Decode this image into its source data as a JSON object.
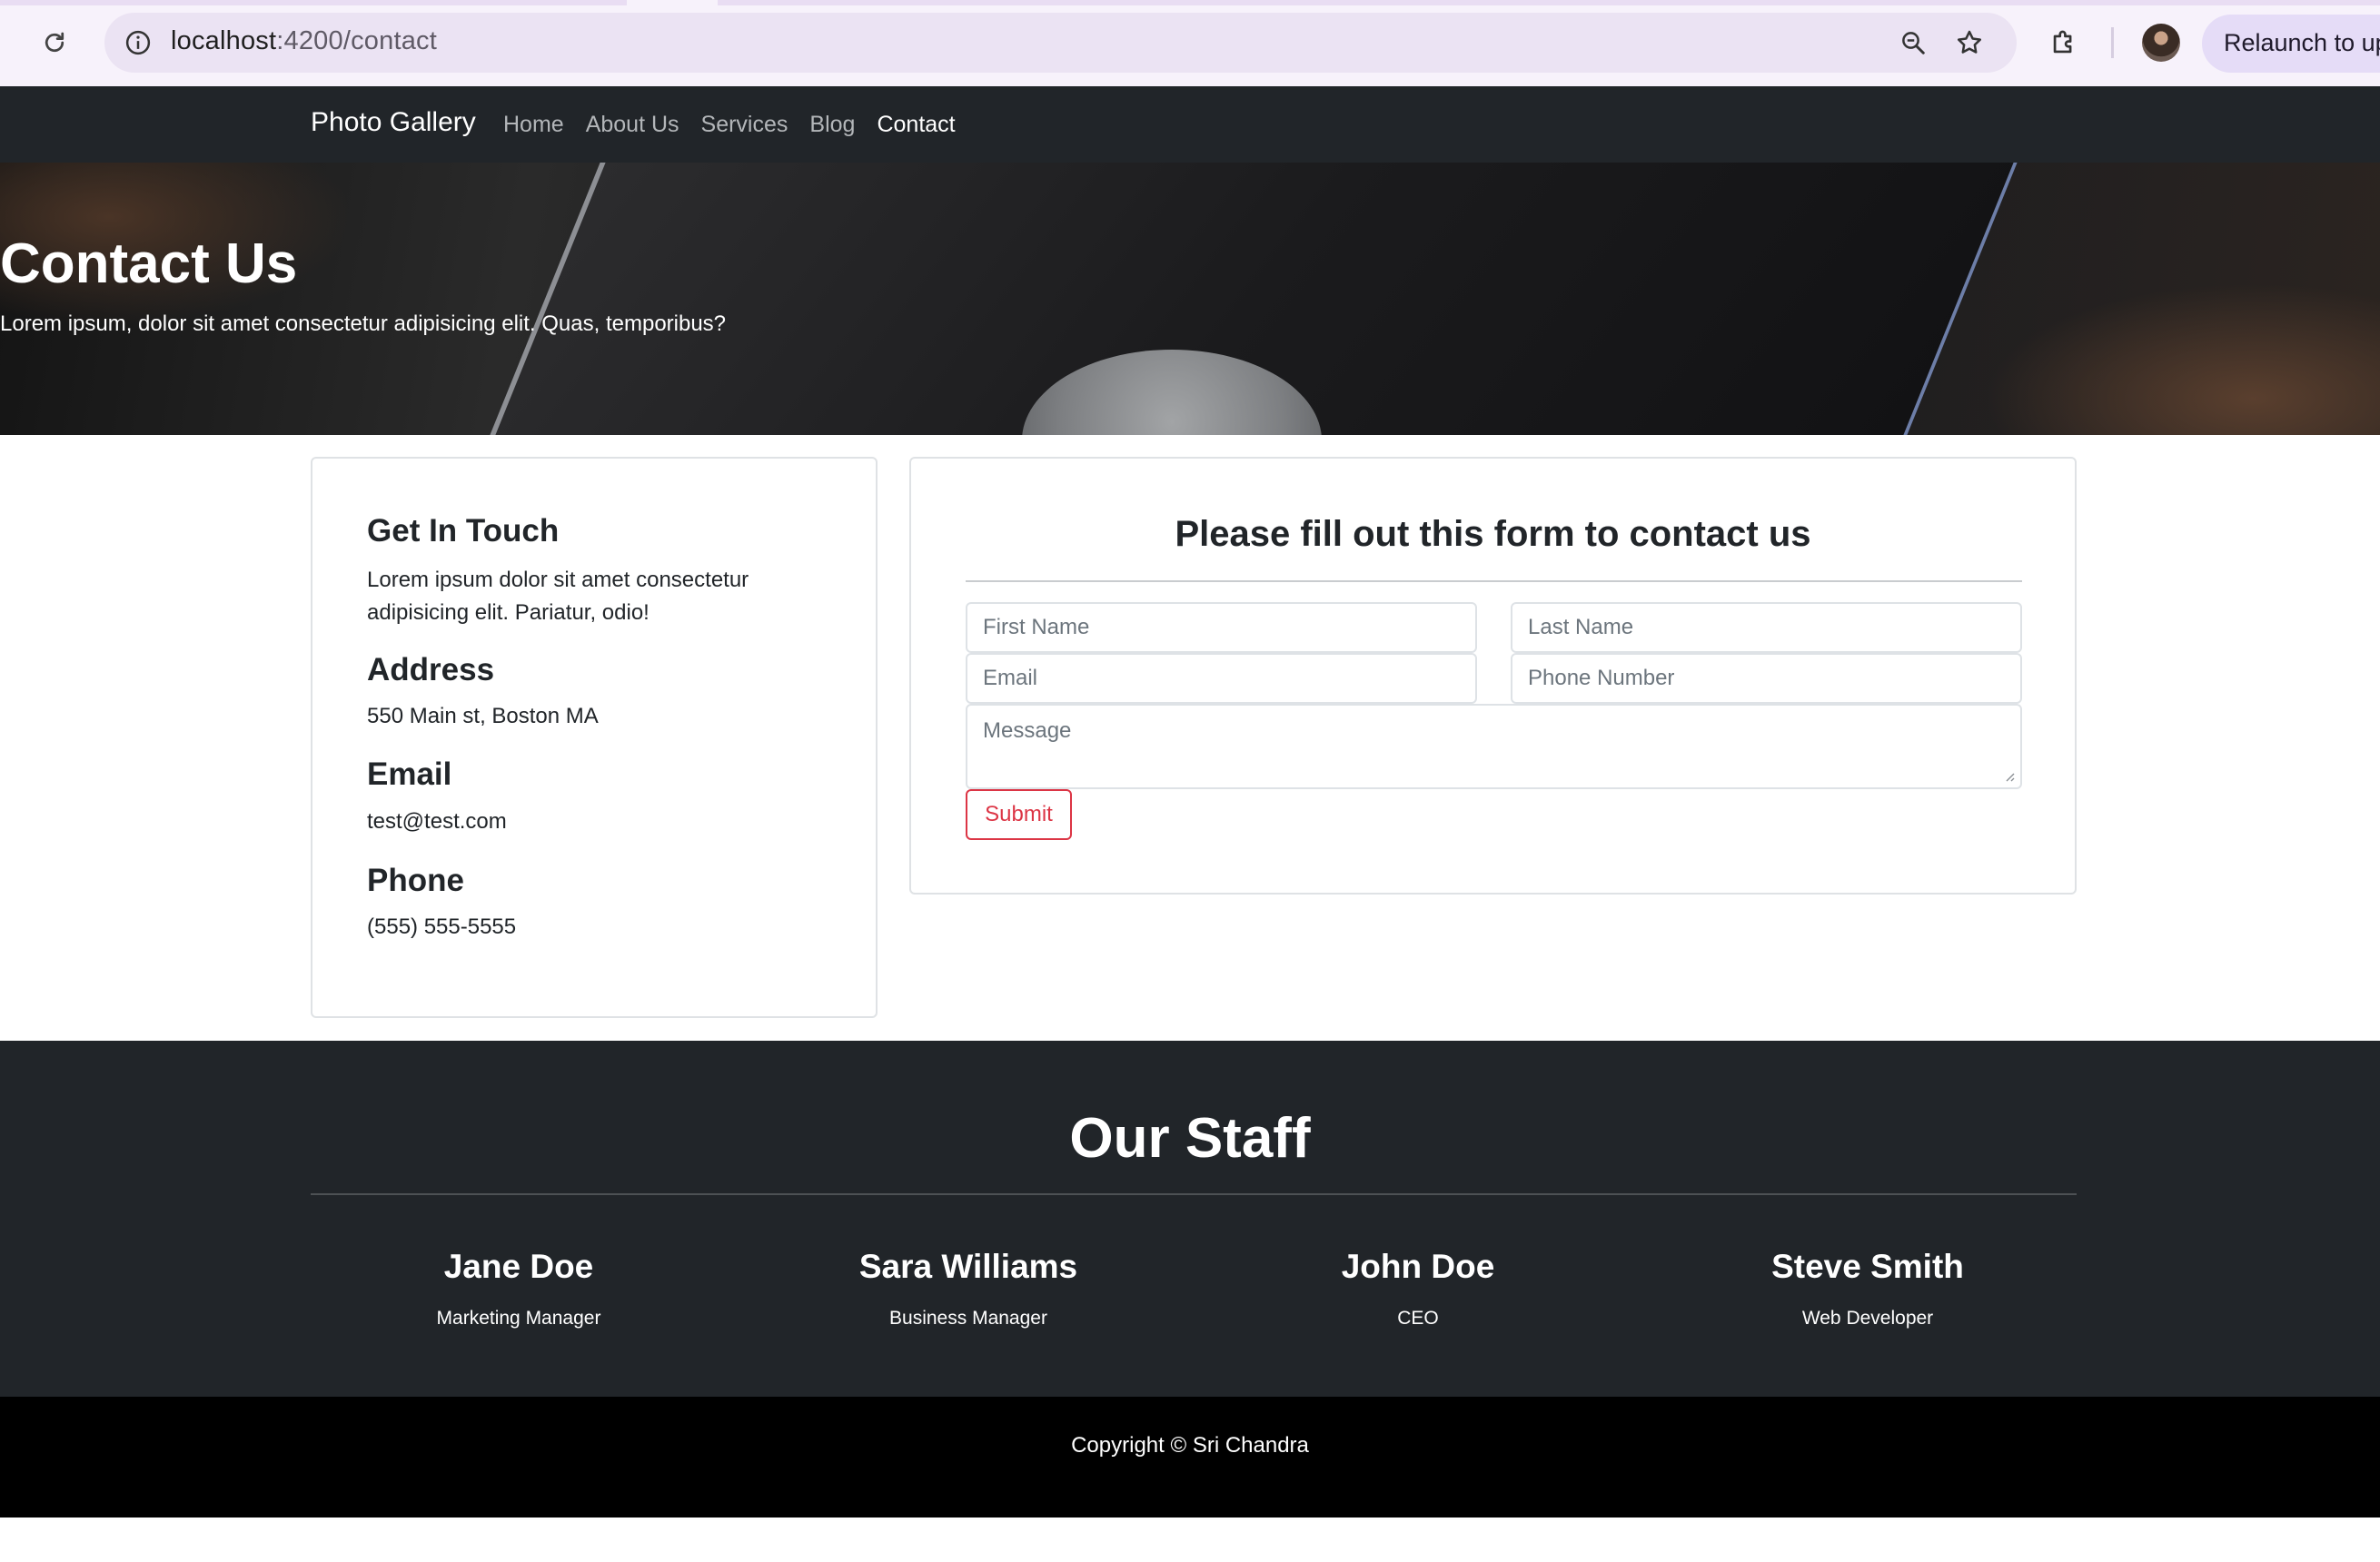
{
  "browser": {
    "url_host": "localhost",
    "url_path": ":4200/contact",
    "relaunch_label": "Relaunch to up",
    "icons": [
      "reload-icon",
      "site-info-icon",
      "zoom-icon",
      "bookmark-star-icon",
      "extensions-icon"
    ]
  },
  "navbar": {
    "brand": "Photo Gallery",
    "links": [
      {
        "label": "Home"
      },
      {
        "label": "About Us"
      },
      {
        "label": "Services"
      },
      {
        "label": "Blog"
      },
      {
        "label": "Contact",
        "active": true
      }
    ]
  },
  "hero": {
    "title": "Contact Us",
    "subtitle": "Lorem ipsum, dolor sit amet consectetur adipisicing elit. Quas, temporibus?"
  },
  "contact_info": {
    "heading": "Get In Touch",
    "text": "Lorem ipsum dolor sit amet consectetur adipisicing elit. Pariatur, odio!",
    "address_heading": "Address",
    "address": "550 Main st, Boston MA",
    "email_heading": "Email",
    "email": "test@test.com",
    "phone_heading": "Phone",
    "phone": "(555) 555-5555"
  },
  "form": {
    "heading": "Please fill out this form to contact us",
    "first_name_placeholder": "First Name",
    "last_name_placeholder": "Last Name",
    "email_placeholder": "Email",
    "phone_placeholder": "Phone Number",
    "message_placeholder": "Message",
    "submit_label": "Submit"
  },
  "staff": {
    "title": "Our Staff",
    "members": [
      {
        "name": "Jane Doe",
        "role": "Marketing Manager"
      },
      {
        "name": "Sara Williams",
        "role": "Business Manager"
      },
      {
        "name": "John Doe",
        "role": "CEO"
      },
      {
        "name": "Steve Smith",
        "role": "Web Developer"
      }
    ]
  },
  "footer": {
    "copyright": "Copyright © Sri Chandra"
  },
  "colors": {
    "navbar_bg": "#212529",
    "staff_bg": "#212529",
    "footer_bg": "#000000",
    "submit_accent": "#dc3545"
  }
}
